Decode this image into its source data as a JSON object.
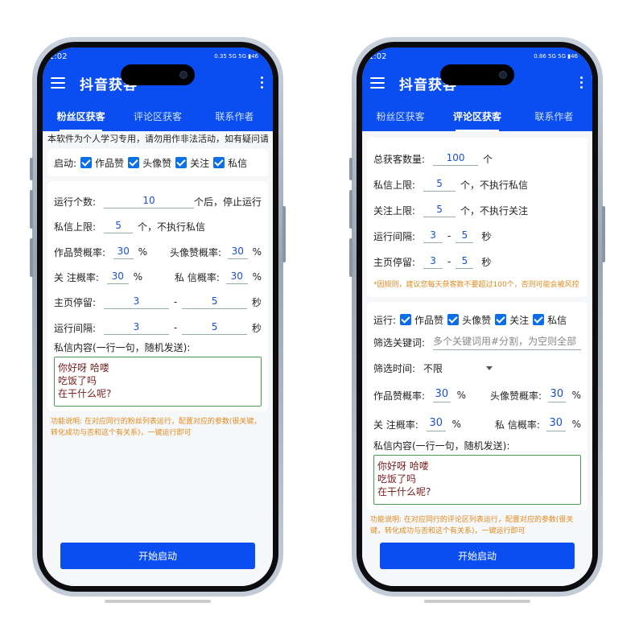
{
  "status_bar": {
    "time": "1:02",
    "right_left": "0.35 5G  5G  ▮46",
    "right_right": "0.86 5G  5G  ▮46"
  },
  "app": {
    "title": "抖音获客"
  },
  "tabs": [
    "粉丝区获客",
    "评论区获客",
    "联系作者"
  ],
  "left": {
    "intro": "本软件为个人学习专用，请勿用作非法活动，如有疑问请联系",
    "enable_label": "启动:",
    "enable_options": [
      "作品赞",
      "头像赞",
      "关注",
      "私信"
    ],
    "run_count_label": "运行个数:",
    "run_count_value": "10",
    "run_count_suffix": "个后，停止运行",
    "pm_limit_label": "私信上限:",
    "pm_limit_value": "5",
    "pm_limit_suffix": "个，不执行私信",
    "work_like_label": "作品赞概率:",
    "work_like_value": "30",
    "avatar_like_label": "头像赞概率:",
    "avatar_like_value": "30",
    "follow_label": "关 注概率:",
    "follow_value": "30",
    "pm_prob_label": "私 信概率:",
    "pm_prob_value": "30",
    "percent": "%",
    "home_stay_label": "主页停留:",
    "home_stay_min": "3",
    "home_stay_max": "5",
    "interval_label": "运行间隔:",
    "interval_min": "3",
    "interval_max": "5",
    "dash": "-",
    "sec": "秒",
    "msg_label": "私信内容(一行一句，随机发送):",
    "msg_lines": [
      "你好呀 哈喽",
      "吃饭了吗",
      "在干什么呢?"
    ],
    "note": "功能说明: 在对应同行的粉丝列表运行，配置对应的参数(很关键，转化成功与否和这个有关系)，一键运行即可",
    "start_button": "开始启动"
  },
  "right": {
    "total_label": "总获客数量:",
    "total_value": "100",
    "total_unit": "个",
    "pm_limit_label": "私信上限:",
    "pm_limit_value": "5",
    "pm_limit_suffix": "个，不执行私信",
    "follow_limit_label": "关注上限:",
    "follow_limit_value": "5",
    "follow_limit_suffix": "个，不执行关注",
    "interval_label": "运行间隔:",
    "interval_min": "3",
    "interval_max": "5",
    "home_stay_label": "主页停留:",
    "home_stay_min": "3",
    "home_stay_max": "5",
    "dash": "-",
    "sec": "秒",
    "warning": "*因规则，建议您每天获客数不要超过100个，否则可能会被风控",
    "run_label": "运行:",
    "run_options": [
      "作品赞",
      "头像赞",
      "关注",
      "私信"
    ],
    "keyword_label": "筛选关键词:",
    "keyword_placeholder": "多个关键词用#分割，为空则全部",
    "time_label": "筛选时间:",
    "time_value": "不限",
    "work_like_label": "作品赞概率:",
    "work_like_value": "30",
    "avatar_like_label": "头像赞概率:",
    "avatar_like_value": "30",
    "follow_label": "关 注概率:",
    "follow_value": "30",
    "pm_prob_label": "私 信概率:",
    "pm_prob_value": "30",
    "percent": "%",
    "msg_label": "私信内容(一行一句，随机发送):",
    "msg_lines": [
      "你好呀 哈喽",
      "吃饭了吗",
      "在干什么呢?"
    ],
    "note": "功能说明: 在对应同行的评论区列表运行，配置对应的参数(很关键，转化成功与否和这个有关系)，一键运行即可",
    "start_button": "开始启动"
  }
}
